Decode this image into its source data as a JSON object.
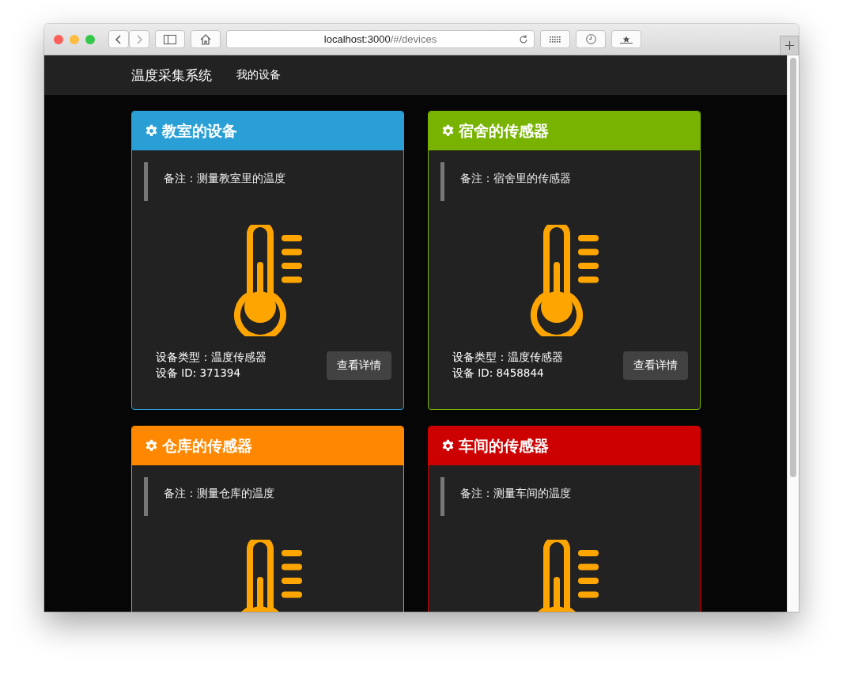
{
  "browser": {
    "url_host": "localhost:3000",
    "url_path": "/#/devices"
  },
  "navbar": {
    "brand": "温度采集系统",
    "links": [
      {
        "label": "我的设备"
      }
    ]
  },
  "devices": [
    {
      "title": "教室的设备",
      "color": "#2a9fd6",
      "note": "备注：测量教室里的温度",
      "type": "设备类型：温度传感器",
      "id": "设备 ID: 371394",
      "button": "查看详情"
    },
    {
      "title": "宿舍的传感器",
      "color": "#77b300",
      "note": "备注：宿舍里的传感器",
      "type": "设备类型：温度传感器",
      "id": "设备 ID: 8458844",
      "button": "查看详情"
    },
    {
      "title": "仓库的传感器",
      "color": "#ff8800",
      "note": "备注：测量仓库的温度"
    },
    {
      "title": "车间的传感器",
      "color": "#cc0000",
      "note": "备注：测量车间的温度"
    }
  ]
}
